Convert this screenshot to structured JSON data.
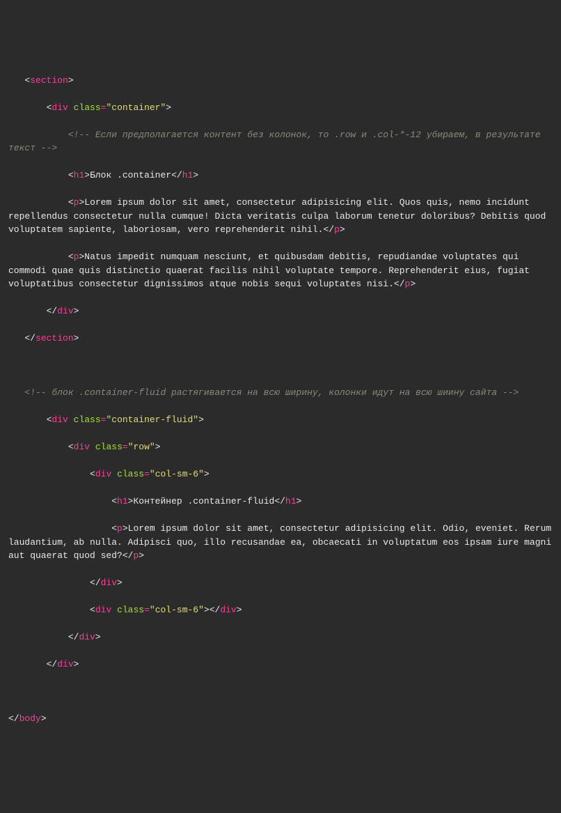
{
  "code": {
    "l1": {
      "tag": "section"
    },
    "l2": {
      "tag": "div",
      "attr": "class",
      "val": "\"container\""
    },
    "l3": {
      "comment": "<!-- Если предполагается контент без колонок, то .row и .col-*-12 убираем, в результате текст -->"
    },
    "l4": {
      "tag": "h1",
      "text": "Блок .container"
    },
    "l5": {
      "tag": "p",
      "text": "Lorem ipsum dolor sit amet, consectetur adipisicing elit. Quos quis, nemo incidunt repellendus consectetur nulla cumque! Dicta veritatis culpa laborum tenetur doloribus? Debitis quod voluptatem sapiente, laboriosam, vero reprehenderit nihil."
    },
    "l6": {
      "tag": "p",
      "text": "Natus impedit numquam nesciunt, et quibusdam debitis, repudiandae voluptates qui commodi quae quis distinctio quaerat facilis nihil voluptate tempore. Reprehenderit eius, fugiat voluptatibus consectetur dignissimos atque nobis sequi voluptates nisi."
    },
    "l7": {
      "tag": "div"
    },
    "l8": {
      "tag": "section"
    },
    "l9": {
      "comment": "<!-- блок .container-fluid растягивается на всю ширину, колонки идут на всю шиину сайта -->"
    },
    "l10": {
      "tag": "div",
      "attr": "class",
      "val": "\"container-fluid\""
    },
    "l11": {
      "tag": "div",
      "attr": "class",
      "val": "\"row\""
    },
    "l12": {
      "tag": "div",
      "attr": "class",
      "val": "\"col-sm-6\""
    },
    "l13": {
      "tag": "h1",
      "text": "Контейнер .container-fluid"
    },
    "l14": {
      "tag": "p",
      "text": "Lorem ipsum dolor sit amet, consectetur adipisicing elit. Odio, eveniet. Rerum laudantium, ab nulla. Adipisci quo, illo recusandae ea, obcaecati in voluptatum eos ipsam iure magni aut quaerat quod sed?"
    },
    "l15": {
      "tag": "div"
    },
    "l16": {
      "tag": "div",
      "attr": "class",
      "val": "\"col-sm-6\""
    },
    "l17": {
      "tag": "div"
    },
    "l18": {
      "tag": "div"
    },
    "l19": {
      "tag": "body"
    }
  }
}
